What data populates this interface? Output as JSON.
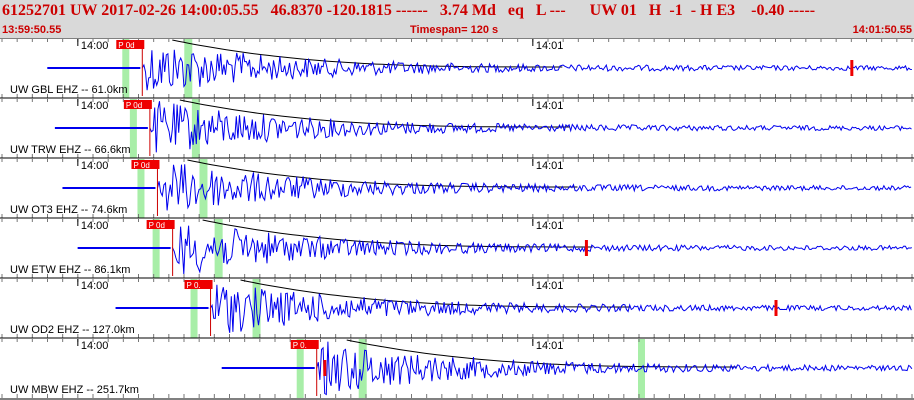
{
  "header": {
    "event_id": "61252701",
    "network": "UW",
    "datetime": "2017-02-26 14:00:05.55",
    "latitude": "46.8370",
    "longitude": "-120.1815",
    "depth": "------",
    "magnitude": "3.74",
    "magnitude_type": "Md",
    "event_type": "eq",
    "location_flag": "L ---",
    "channel_info": "UW 01",
    "channel_flags": "H  -1  - H E3",
    "value": "-0.40 -----"
  },
  "timebar": {
    "start_time": "13:59:50.55",
    "timespan": "Timespan= 120 s",
    "end_time": "14:01:50.55"
  },
  "minute_ticks": [
    "14:00",
    "14:01"
  ],
  "colors": {
    "header_bg": "#d9d9d9",
    "header_text": "#cc0000",
    "trace": "#0000ee",
    "pick_box": "#ee0000",
    "window_band": "#a8eea8",
    "coda": "#000000"
  },
  "traces": [
    {
      "label": "UW GBL EHZ -- 61.0km",
      "pick": "P 0d",
      "pick_time_s": 18.5,
      "end_pick_s": 112.0
    },
    {
      "label": "UW TRW EHZ -- 66.6km",
      "pick": "P 0d",
      "pick_time_s": 19.5,
      "end_pick_s": null
    },
    {
      "label": "UW OT3 EHZ -- 74.6km",
      "pick": "P 0d",
      "pick_time_s": 20.5,
      "end_pick_s": null
    },
    {
      "label": "UW ETW EHZ -- 86.1km",
      "pick": "P 0d",
      "pick_time_s": 22.5,
      "end_pick_s": 77.0
    },
    {
      "label": "UW OD2 EHZ -- 127.0km",
      "pick": "P 0.",
      "pick_time_s": 27.5,
      "end_pick_s": 102.0
    },
    {
      "label": "UW MBW EHZ -- 251.7km",
      "pick": "P 0.",
      "pick_time_s": 41.5,
      "end_pick_s": 42.5
    }
  ]
}
